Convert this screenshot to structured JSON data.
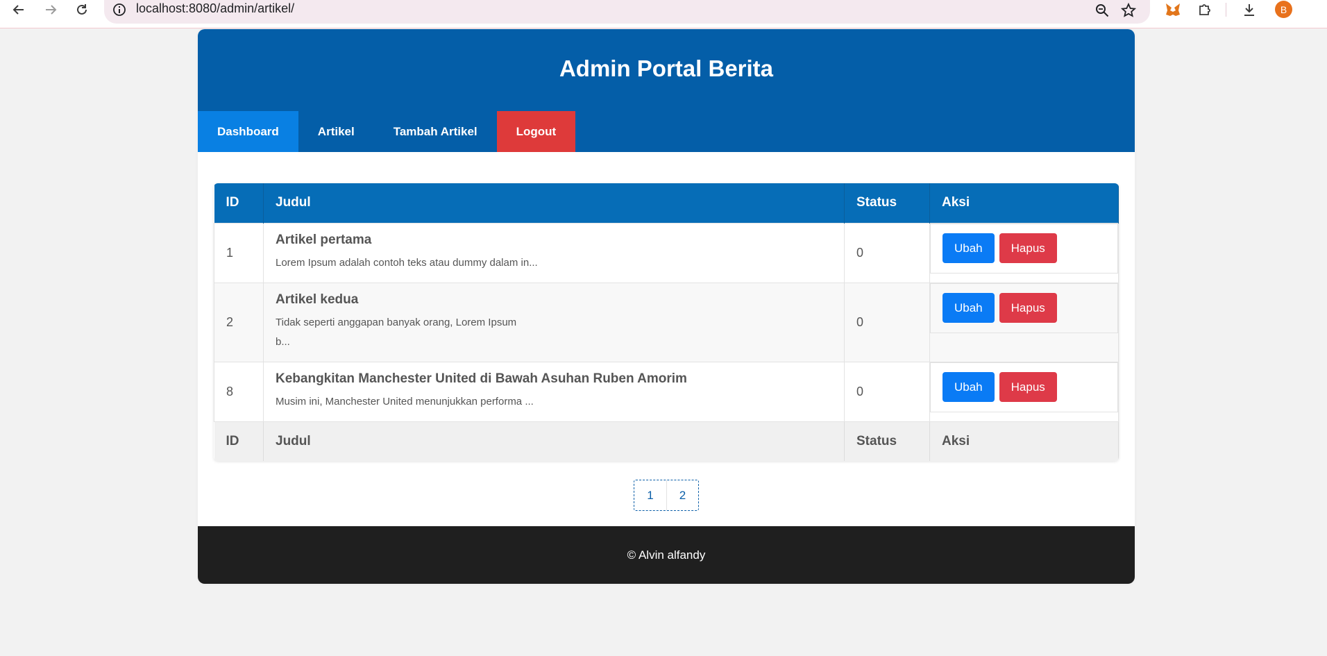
{
  "browser": {
    "url": "localhost:8080/admin/artikel/",
    "profile_initial": "B"
  },
  "header": {
    "title": "Admin Portal Berita"
  },
  "nav": {
    "items": [
      {
        "label": "Dashboard"
      },
      {
        "label": "Artikel"
      },
      {
        "label": "Tambah Artikel"
      },
      {
        "label": "Logout"
      }
    ]
  },
  "table": {
    "columns": [
      "ID",
      "Judul",
      "Status",
      "Aksi"
    ],
    "rows": [
      {
        "id": "1",
        "title": "Artikel pertama",
        "excerpt": "Lorem Ipsum adalah contoh teks atau dummy dalam in...",
        "excerpt2": "",
        "status": "0",
        "edit": "Ubah",
        "delete": "Hapus"
      },
      {
        "id": "2",
        "title": "Artikel kedua",
        "excerpt": "Tidak seperti anggapan banyak orang, Lorem Ipsum",
        "excerpt2": "b...",
        "status": "0",
        "edit": "Ubah",
        "delete": "Hapus"
      },
      {
        "id": "8",
        "title": "Kebangkitan Manchester United di Bawah Asuhan Ruben Amorim",
        "excerpt": "Musim ini, Manchester United menunjukkan performa ...",
        "excerpt2": "",
        "status": "0",
        "edit": "Ubah",
        "delete": "Hapus"
      }
    ],
    "footer_columns": [
      "ID",
      "Judul",
      "Status",
      "Aksi"
    ]
  },
  "pagination": {
    "pages": [
      "1",
      "2"
    ]
  },
  "footer": {
    "text": "© Alvin alfandy"
  },
  "colors": {
    "header_bg": "#045ea8",
    "nav_active": "#0980e3",
    "logout": "#de3a3a",
    "ubah": "#0a7bf5",
    "hapus": "#de3a48",
    "footer_bg": "#1f1f1f"
  }
}
